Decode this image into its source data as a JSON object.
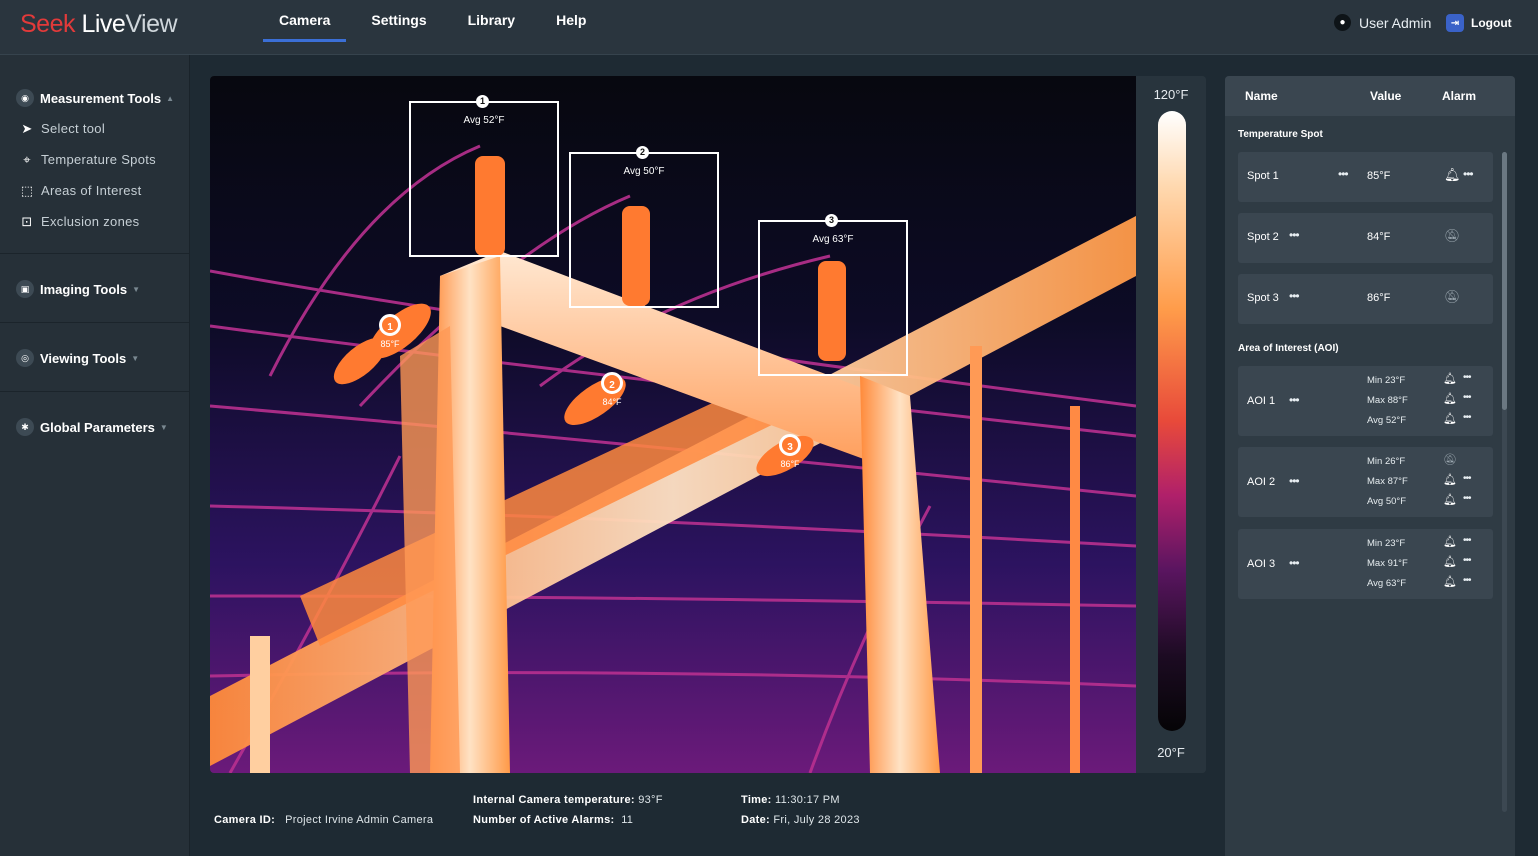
{
  "brand": {
    "seek": "Seek",
    "live": "Live",
    "view": "View"
  },
  "nav": {
    "items": [
      "Camera",
      "Settings",
      "Library",
      "Help"
    ],
    "active": "Camera"
  },
  "user": {
    "label": "User Admin",
    "logout": "Logout"
  },
  "sidebar": {
    "measurement": {
      "label": "Measurement Tools",
      "tools": [
        "Select tool",
        "Temperature Spots",
        "Areas of Interest",
        "Exclusion zones"
      ]
    },
    "imaging": "Imaging Tools",
    "viewing": "Viewing Tools",
    "global": "Global Parameters"
  },
  "viewer": {
    "boxes": [
      {
        "num": "1",
        "label": "Avg 52°F"
      },
      {
        "num": "2",
        "label": "Avg 50°F"
      },
      {
        "num": "3",
        "label": "Avg 63°F"
      }
    ],
    "spots": [
      {
        "num": "1",
        "temp": "85°F"
      },
      {
        "num": "2",
        "temp": "84°F"
      },
      {
        "num": "3",
        "temp": "86°F"
      }
    ],
    "scale_max": "120°F",
    "scale_min": "20°F"
  },
  "info": {
    "camera_id_label": "Camera ID:",
    "camera_id": "Project Irvine Admin Camera",
    "internal_temp_label": "Internal Camera temperature:",
    "internal_temp": "93°F",
    "alarms_label": "Number of Active Alarms:",
    "alarms": "11",
    "time_label": "Time:",
    "time": "11:30:17 PM",
    "date_label": "Date:",
    "date": "Fri, July 28 2023"
  },
  "panel": {
    "headers": [
      "Name",
      "Value",
      "Alarm"
    ],
    "spot_section": "Temperature Spot",
    "spots": [
      {
        "name": "Spot 1",
        "value": "85°F",
        "alarm": true
      },
      {
        "name": "Spot 2",
        "value": "84°F",
        "alarm": false
      },
      {
        "name": "Spot 3",
        "value": "86°F",
        "alarm": false
      }
    ],
    "aoi_section": "Area of Interest (AOI)",
    "aois": [
      {
        "name": "AOI 1",
        "rows": [
          {
            "label": "Min 23°F",
            "alarm": true
          },
          {
            "label": "Max 88°F",
            "alarm": true
          },
          {
            "label": "Avg 52°F",
            "alarm": true
          }
        ]
      },
      {
        "name": "AOI 2",
        "rows": [
          {
            "label": "Min 26°F",
            "alarm": false
          },
          {
            "label": "Max 87°F",
            "alarm": true
          },
          {
            "label": "Avg 50°F",
            "alarm": true
          }
        ]
      },
      {
        "name": "AOI 3",
        "rows": [
          {
            "label": "Min 23°F",
            "alarm": true
          },
          {
            "label": "Max 91°F",
            "alarm": true
          },
          {
            "label": "Avg 63°F",
            "alarm": true
          }
        ]
      }
    ]
  }
}
